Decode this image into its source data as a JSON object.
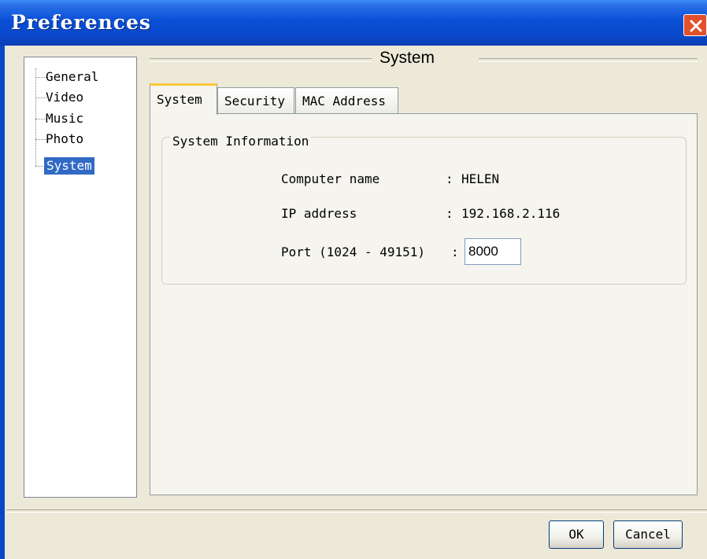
{
  "window": {
    "title": "Preferences"
  },
  "tree": {
    "items": [
      {
        "label": "General",
        "selected": false
      },
      {
        "label": "Video",
        "selected": false
      },
      {
        "label": "Music",
        "selected": false
      },
      {
        "label": "Photo",
        "selected": false
      },
      {
        "label": "System",
        "selected": true
      }
    ]
  },
  "section": {
    "title": "System"
  },
  "tabs": [
    {
      "label": "System",
      "active": true
    },
    {
      "label": "Security",
      "active": false
    },
    {
      "label": "MAC Address",
      "active": false
    }
  ],
  "system_info": {
    "legend": "System Information",
    "computer_name_label": "Computer name",
    "computer_name_sep": ":",
    "computer_name_value": "HELEN",
    "ip_label": "IP address",
    "ip_sep": ":",
    "ip_value": "192.168.2.116",
    "port_label": "Port (1024 - 49151)",
    "port_sep": ":",
    "port_value": "8000"
  },
  "buttons": {
    "ok": "OK",
    "cancel": "Cancel"
  },
  "colors": {
    "titlebar": "#0a4fd6",
    "selection": "#316ac5",
    "tab_highlight": "#ffc83c",
    "close": "#e2502c"
  },
  "icons": {
    "close": "close-icon"
  }
}
